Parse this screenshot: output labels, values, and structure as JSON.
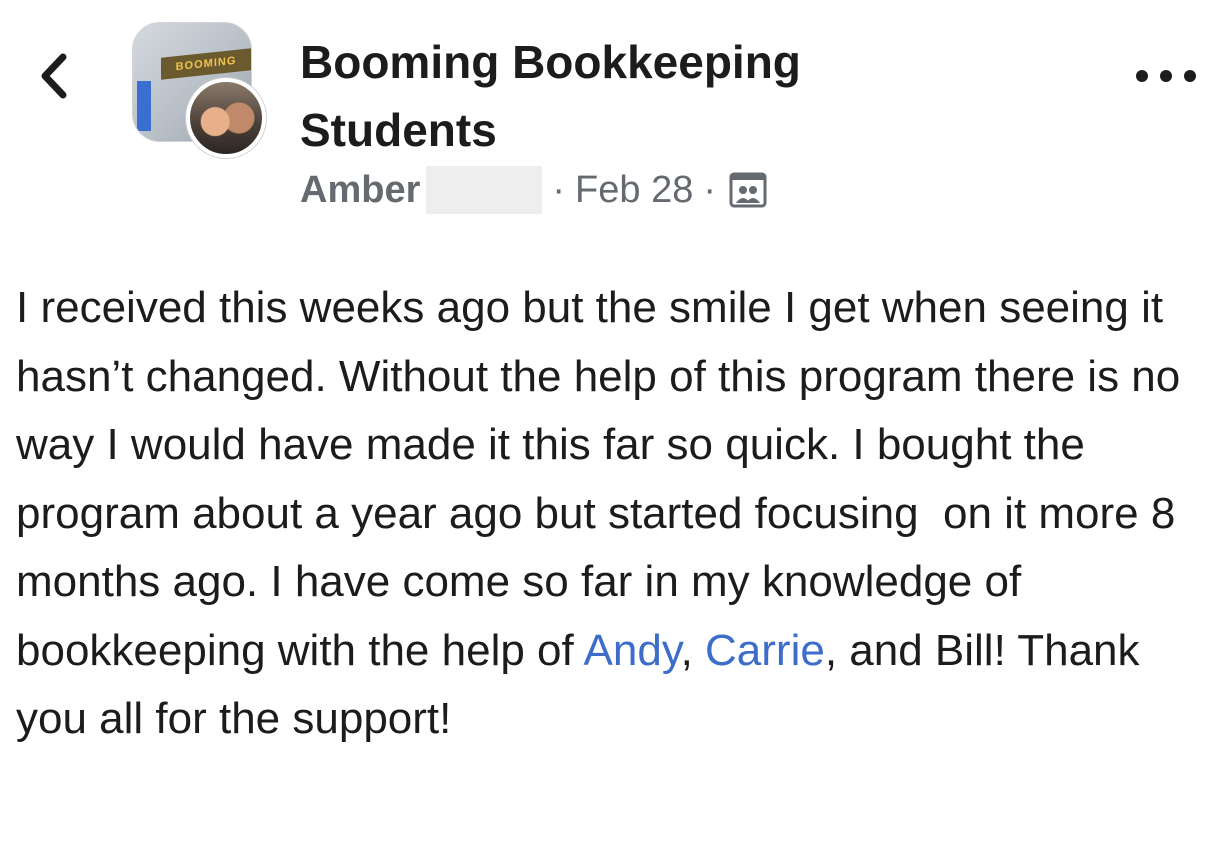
{
  "header": {
    "back_icon": "chevron-left-icon",
    "group_name": "Booming Bookkeeping Students",
    "group_photo_sign_text": "BOOMING",
    "more_icon": "ellipsis-icon"
  },
  "post": {
    "author": "Amber",
    "separator": "·",
    "date": "Feb 28",
    "audience_icon": "group-members-icon",
    "body_part1": "I received this weeks ago but the smile I get when seeing it hasn’t changed. Without the help of this program there is no way I would have made it this far so quick. I bought the program about a year ago but started focusing  on it more 8 months ago. I have come so far in my knowledge of bookkeeping with the help of ",
    "mention1": "Andy",
    "between_mentions": ", ",
    "mention2": "Carrie",
    "body_part2": ", and Bill! Thank you all for the support!"
  },
  "colors": {
    "text": "#1c1c1c",
    "meta_text": "#656a70",
    "mention_link": "#3b6dc9",
    "background": "#ffffff"
  }
}
